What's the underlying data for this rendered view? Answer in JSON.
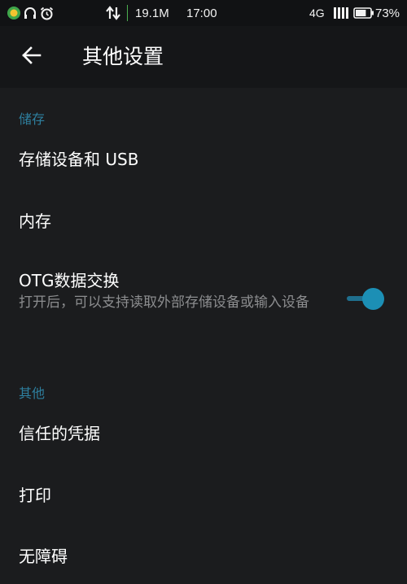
{
  "status_bar": {
    "network_speed": "19.1M",
    "time": "17:00",
    "network_type": "4G",
    "battery_percent": "73%",
    "battery_level": 0.73,
    "icons": [
      "app-notification-icon",
      "headset-icon",
      "alarm-icon",
      "data-transfer-icon",
      "signal-icon",
      "battery-icon"
    ]
  },
  "toolbar": {
    "title": "其他设置",
    "back_icon": "arrow-left-icon"
  },
  "sections": {
    "storage": {
      "header": "储存",
      "items": [
        {
          "title": "存储设备和 USB"
        },
        {
          "title": "内存"
        },
        {
          "title": "OTG数据交换",
          "summary": "打开后，可以支持读取外部存储设备或输入设备",
          "toggle_on": true
        }
      ]
    },
    "other": {
      "header": "其他",
      "items": [
        {
          "title": "信任的凭据"
        },
        {
          "title": "打印"
        },
        {
          "title": "无障碍"
        }
      ]
    }
  },
  "colors": {
    "accent": "#1c8fb5",
    "section_header": "#2e7f9f",
    "background": "#1b1c1e"
  }
}
